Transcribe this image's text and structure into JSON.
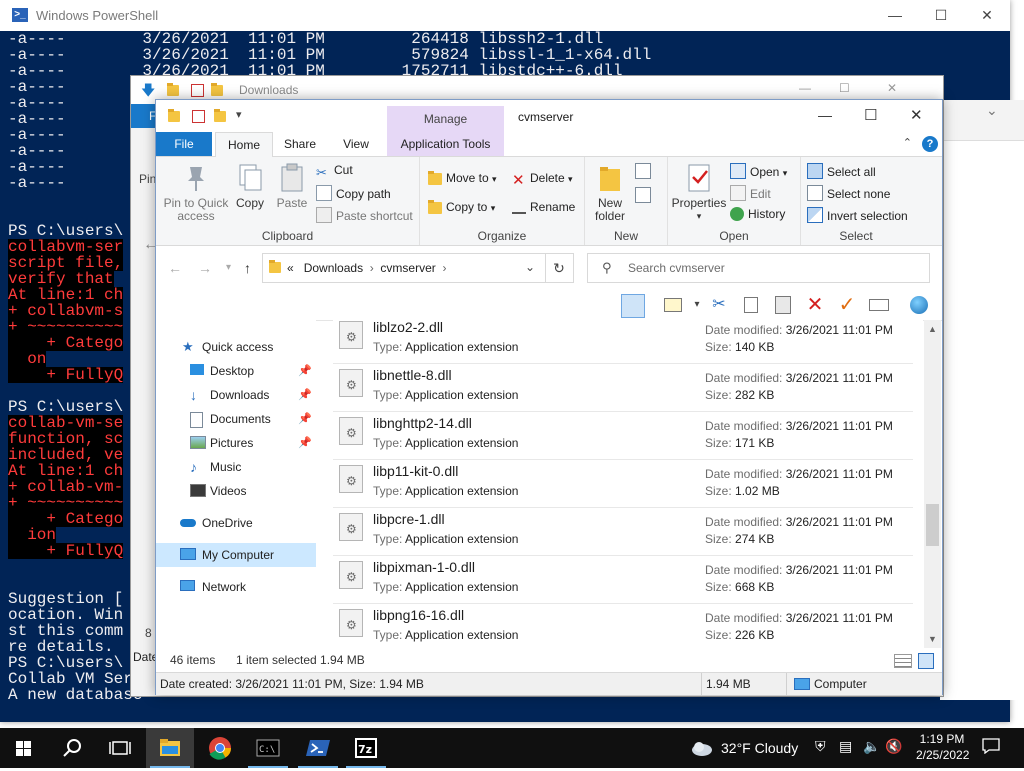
{
  "powershell": {
    "title": "Windows PowerShell",
    "listing_lines": [
      "-a----        3/26/2021  11:01 PM         264418 libssh2-1.dll",
      "-a----        3/26/2021  11:01 PM         579824 libssl-1_1-x64.dll",
      "-a----        3/26/2021  11:01 PM        1752711 libstdc++-6.dll",
      "-a----",
      "-a----",
      "-a----",
      "-a----",
      "-a----",
      "-a----",
      "-a----",
      "-a----"
    ],
    "prompt_lines": [
      "PS C:\\users\\",
      "PS C:\\users\\"
    ],
    "error_block_1": [
      "collabvm-ser",
      "script file,",
      "verify that",
      "At line:1 ch",
      "+ collabvm-s",
      "+ ~~~~~~~~~~",
      "    + Catego",
      "  on",
      "    + FullyQ"
    ],
    "error_block_2": [
      "collab-vm-se",
      "function, sc",
      "included, ve",
      "At line:1 ch",
      "+ collab-vm-",
      "+ ~~~~~~~~~~",
      "    + Catego",
      "  ion",
      "    + FullyQ"
    ],
    "tail_lines": [
      "Suggestion [",
      "ocation. Win",
      "st this comm",
      "re details.",
      "PS C:\\users\\",
      "Collab VM Serve",
      "A new database"
    ]
  },
  "bg_explorer": {
    "title": "Downloads",
    "file_tab": "Fi",
    "pin_label": "Pin",
    "side_text_1": "8 i",
    "side_text_2": "Date"
  },
  "explorer": {
    "title": "cvmserver",
    "context_tab": "Manage",
    "tabs": {
      "file": "File",
      "home": "Home",
      "share": "Share",
      "view": "View",
      "app_tools": "Application Tools"
    },
    "ribbon": {
      "clipboard": {
        "group": "Clipboard",
        "pin": "Pin to Quick access",
        "copy": "Copy",
        "paste": "Paste",
        "cut": "Cut",
        "copy_path": "Copy path",
        "paste_shortcut": "Paste shortcut"
      },
      "organize": {
        "group": "Organize",
        "move_to": "Move to",
        "copy_to": "Copy to",
        "delete": "Delete",
        "rename": "Rename"
      },
      "new": {
        "group": "New",
        "new_folder": "New folder"
      },
      "open": {
        "group": "Open",
        "properties": "Properties",
        "open": "Open",
        "edit": "Edit",
        "history": "History"
      },
      "select": {
        "group": "Select",
        "select_all": "Select all",
        "select_none": "Select none",
        "invert": "Invert selection"
      }
    },
    "address": {
      "overflow": "«",
      "crumbs": [
        "Downloads",
        "cvmserver"
      ],
      "search_placeholder": "Search cvmserver"
    },
    "nav": [
      {
        "label": "Quick access",
        "icon": "star-icon",
        "pinned": false,
        "selected": false
      },
      {
        "label": "Desktop",
        "icon": "desktop-icon",
        "pinned": true,
        "selected": false
      },
      {
        "label": "Downloads",
        "icon": "download-icon",
        "pinned": true,
        "selected": false
      },
      {
        "label": "Documents",
        "icon": "documents-icon",
        "pinned": true,
        "selected": false
      },
      {
        "label": "Pictures",
        "icon": "pictures-icon",
        "pinned": true,
        "selected": false
      },
      {
        "label": "Music",
        "icon": "music-icon",
        "pinned": false,
        "selected": false
      },
      {
        "label": "Videos",
        "icon": "videos-icon",
        "pinned": false,
        "selected": false
      },
      {
        "label": "OneDrive",
        "icon": "cloud-icon",
        "pinned": false,
        "selected": false
      },
      {
        "label": "My Computer",
        "icon": "computer-icon",
        "pinned": false,
        "selected": true
      },
      {
        "label": "Network",
        "icon": "network-icon",
        "pinned": false,
        "selected": false
      }
    ],
    "labels": {
      "type": "Type:",
      "date_modified": "Date modified:",
      "size": "Size:"
    },
    "files": [
      {
        "name": "liblzo2-2.dll",
        "type": "Application extension",
        "modified": "3/26/2021 11:01 PM",
        "size": "140 KB"
      },
      {
        "name": "libnettle-8.dll",
        "type": "Application extension",
        "modified": "3/26/2021 11:01 PM",
        "size": "282 KB"
      },
      {
        "name": "libnghttp2-14.dll",
        "type": "Application extension",
        "modified": "3/26/2021 11:01 PM",
        "size": "171 KB"
      },
      {
        "name": "libp11-kit-0.dll",
        "type": "Application extension",
        "modified": "3/26/2021 11:01 PM",
        "size": "1.02 MB"
      },
      {
        "name": "libpcre-1.dll",
        "type": "Application extension",
        "modified": "3/26/2021 11:01 PM",
        "size": "274 KB"
      },
      {
        "name": "libpixman-1-0.dll",
        "type": "Application extension",
        "modified": "3/26/2021 11:01 PM",
        "size": "668 KB"
      },
      {
        "name": "libpng16-16.dll",
        "type": "Application extension",
        "modified": "3/26/2021 11:01 PM",
        "size": "226 KB"
      }
    ],
    "status": {
      "item_count": "46 items",
      "selection": "1 item selected  1.94 MB"
    },
    "details": {
      "info": "Date created: 3/26/2021 11:01 PM, Size: 1.94 MB",
      "size": "1.94 MB",
      "location": "Computer"
    }
  },
  "taskbar": {
    "weather": "32°F  Cloudy",
    "time": "1:19 PM",
    "date": "2/25/2022",
    "apps": [
      "start-icon",
      "search-icon",
      "task-view-icon",
      "file-explorer-icon",
      "chrome-icon",
      "terminal-icon",
      "powershell-icon",
      "7zip-icon"
    ]
  },
  "colors": {
    "powershell_bg": "#012456",
    "error_red": "#ff3b3b",
    "accent_blue": "#1979ca",
    "manage_purple": "#e6d8f6",
    "selection_blue": "#cce8ff"
  }
}
